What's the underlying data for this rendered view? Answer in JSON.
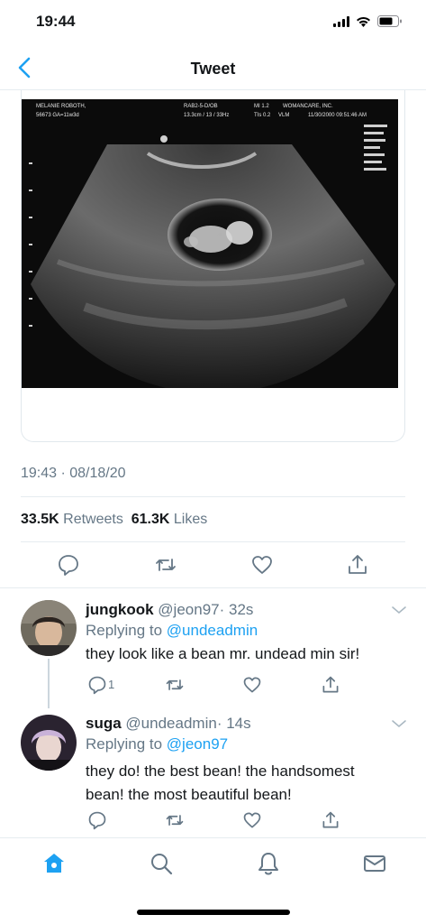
{
  "status_bar": {
    "time": "19:44"
  },
  "nav": {
    "title": "Tweet"
  },
  "tweet": {
    "timestamp": "19:43 · 08/18/20",
    "retweets_count": "33.5K",
    "retweets_label": "Retweets",
    "likes_count": "61.3K",
    "likes_label": "Likes"
  },
  "ultrasound_overlay": {
    "patient": "MELANIE ROBOTH,",
    "clinic": "WOMANCARE, INC.",
    "probe": "RAB2-5-D/OB",
    "mi": "MI 1.2",
    "tib": "TIs 0.2",
    "id_line": "56673 GA=11w3d",
    "depth": "13.3cm / 13 / 33Hz",
    "vlm": "VLM",
    "datetime": "11/30/2000 09:51:46 AM"
  },
  "replies": [
    {
      "name": "jungkook",
      "handle": "@jeon97",
      "time": "· 32s",
      "replying_prefix": "Replying to",
      "replying_to": "@undeadmin",
      "text": "they look like a bean mr. undead min sir!",
      "reply_count": "1"
    },
    {
      "name": "suga",
      "handle": "@undeadmin",
      "time": "· 14s",
      "replying_prefix": "Replying to",
      "replying_to": "@jeon97",
      "text": "they do! the best bean! the handsomest bean! the most beautiful bean!",
      "reply_count": ""
    }
  ],
  "colors": {
    "accent": "#1da1f2",
    "muted": "#657786",
    "text": "#14171a",
    "border": "#e6ecf0"
  },
  "icons": {
    "nav": "chevron-left-icon",
    "actions": [
      "reply-icon",
      "retweet-icon",
      "like-icon",
      "share-icon"
    ],
    "tabs": [
      "home-icon",
      "search-icon",
      "notifications-icon",
      "messages-icon"
    ]
  }
}
